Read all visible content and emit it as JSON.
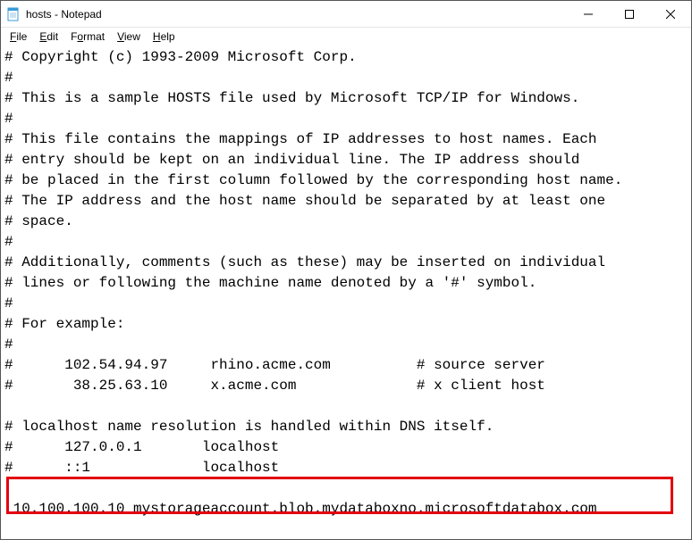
{
  "window": {
    "title": "hosts - Notepad"
  },
  "menu": {
    "file": "File",
    "edit": "Edit",
    "format": "Format",
    "view": "View",
    "help": "Help"
  },
  "document": {
    "lines": [
      "# Copyright (c) 1993-2009 Microsoft Corp.",
      "#",
      "# This is a sample HOSTS file used by Microsoft TCP/IP for Windows.",
      "#",
      "# This file contains the mappings of IP addresses to host names. Each",
      "# entry should be kept on an individual line. The IP address should",
      "# be placed in the first column followed by the corresponding host name.",
      "# The IP address and the host name should be separated by at least one",
      "# space.",
      "#",
      "# Additionally, comments (such as these) may be inserted on individual",
      "# lines or following the machine name denoted by a '#' symbol.",
      "#",
      "# For example:",
      "#",
      "#      102.54.94.97     rhino.acme.com          # source server",
      "#       38.25.63.10     x.acme.com              # x client host",
      "",
      "# localhost name resolution is handled within DNS itself.",
      "#      127.0.0.1       localhost",
      "#      ::1             localhost",
      "",
      " 10.100.100.10 mystorageaccount.blob.mydataboxno.microsoftdatabox.com"
    ]
  }
}
